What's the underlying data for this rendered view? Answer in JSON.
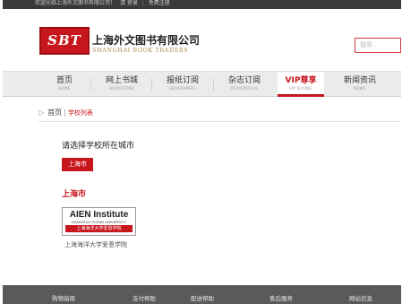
{
  "topbar": {
    "welcome": "欢迎光临上海外文图书有限公司！",
    "login": "请 登录",
    "sep": "|",
    "register": "免费注册"
  },
  "header": {
    "logo_mark": "SBT",
    "company_cn": "上海外文图书有限公司",
    "company_en": "SHANGHAI BOOK TRADERS",
    "search_placeholder": "搜索..."
  },
  "nav": {
    "items": [
      {
        "label": "首页",
        "sub": "HOME"
      },
      {
        "label": "网上书城",
        "sub": "BOOKSTORE"
      },
      {
        "label": "报纸订阅",
        "sub": "NEWSPAPERS"
      },
      {
        "label": "杂志订阅",
        "sub": "PERIODICALS"
      },
      {
        "label": "VIP尊享",
        "sub": "VIP BUYING"
      },
      {
        "label": "新闻资讯",
        "sub": "NEWS"
      }
    ]
  },
  "breadcrumb": {
    "arrow": "▷",
    "home": "首页",
    "sep": "|",
    "current": "学校列表"
  },
  "main": {
    "prompt": "请选择学校所在城市",
    "city_button": "上海市",
    "city_heading": "上海市",
    "school": {
      "logo_title": "AIEN Institute",
      "logo_subtitle": "SHANGHAI OCEAN UNIVERSITY",
      "logo_cn": "上海海洋大学爱恩学院",
      "name": "上海海洋大学爱恩学院"
    }
  },
  "footer": {
    "items": [
      "购物指南",
      "支付帮助",
      "配送帮助",
      "售后服务",
      "网站信息"
    ]
  },
  "colors": {
    "brand_red": "#c8161d",
    "topbar": "#3a3a3a",
    "footer": "#5a5a5a"
  }
}
